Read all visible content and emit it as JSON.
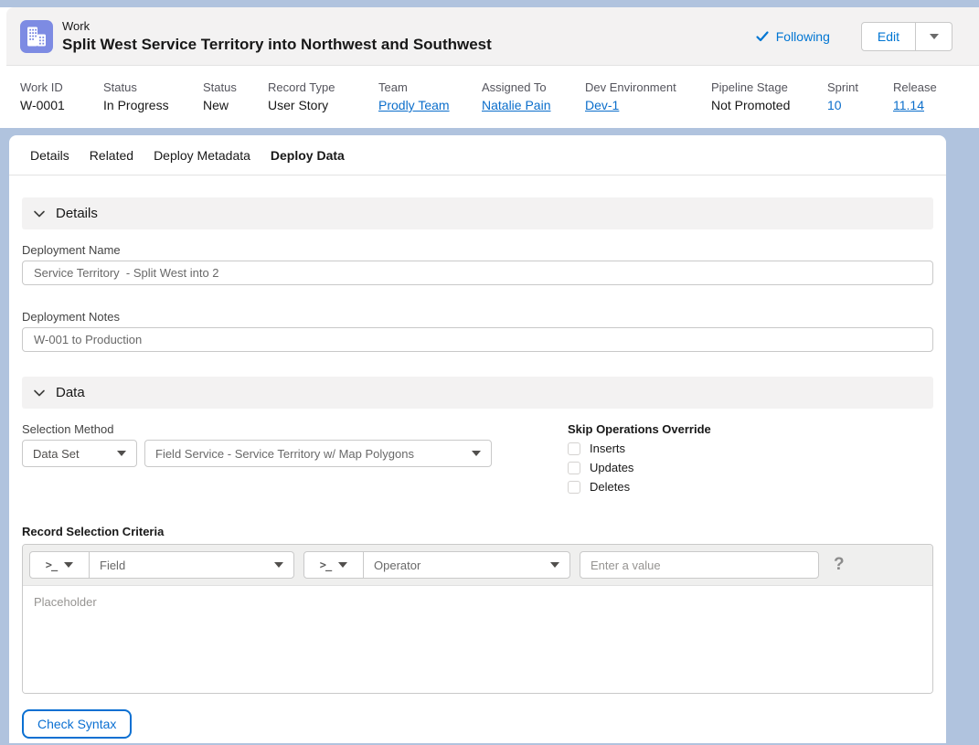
{
  "colors": {
    "accent": "#0176d3",
    "link": "#0b6ecb",
    "icon_bg": "#7d8be3",
    "page_bg": "#b0c3de",
    "section_bg": "#f3f2f2"
  },
  "header": {
    "object_label": "Work",
    "title": "Split West Service Territory into Northwest and Southwest",
    "following_label": "Following",
    "edit_label": "Edit"
  },
  "highlight_fields": {
    "items": [
      {
        "label": "Work ID",
        "value": "W-0001",
        "link": false
      },
      {
        "label": "Status",
        "value": "In Progress",
        "link": false
      },
      {
        "label": "Status",
        "value": "New",
        "link": false
      },
      {
        "label": "Record Type",
        "value": "User Story",
        "link": false
      },
      {
        "label": "Team",
        "value": "Prodly Team",
        "link": true
      },
      {
        "label": "Assigned To",
        "value": "Natalie Pain",
        "link": true
      },
      {
        "label": "Dev Environment",
        "value": "Dev-1",
        "link": true
      },
      {
        "label": "Pipeline Stage",
        "value": "Not Promoted",
        "link": false
      },
      {
        "label": "Sprint",
        "value": "10",
        "link": true,
        "underline": false
      },
      {
        "label": "Release",
        "value": "11.14",
        "link": true
      }
    ]
  },
  "tabs": [
    {
      "label": "Details",
      "active": false
    },
    {
      "label": "Related",
      "active": false
    },
    {
      "label": "Deploy Metadata",
      "active": false
    },
    {
      "label": "Deploy Data",
      "active": true
    }
  ],
  "sections": {
    "details_title": "Details",
    "data_title": "Data"
  },
  "form": {
    "deployment_name_label": "Deployment Name",
    "deployment_name_value": "Service Territory  - Split West into 2",
    "deployment_notes_label": "Deployment Notes",
    "deployment_notes_value": "W-001 to Production",
    "selection_method_label": "Selection Method",
    "selection_method_value": "Data Set",
    "data_set_value": "Field Service - Service Territory w/ Map Polygons",
    "skip_operations_label": "Skip Operations Override",
    "skip_options": [
      {
        "label": "Inserts",
        "checked": false
      },
      {
        "label": "Updates",
        "checked": false
      },
      {
        "label": "Deletes",
        "checked": false
      }
    ]
  },
  "criteria": {
    "label": "Record Selection Criteria",
    "prompt_glyph": ">_",
    "field_placeholder": "Field",
    "operator_placeholder": "Operator",
    "value_placeholder": "Enter a value",
    "help_glyph": "?",
    "editor_placeholder": "Placeholder",
    "check_syntax_label": "Check Syntax"
  }
}
